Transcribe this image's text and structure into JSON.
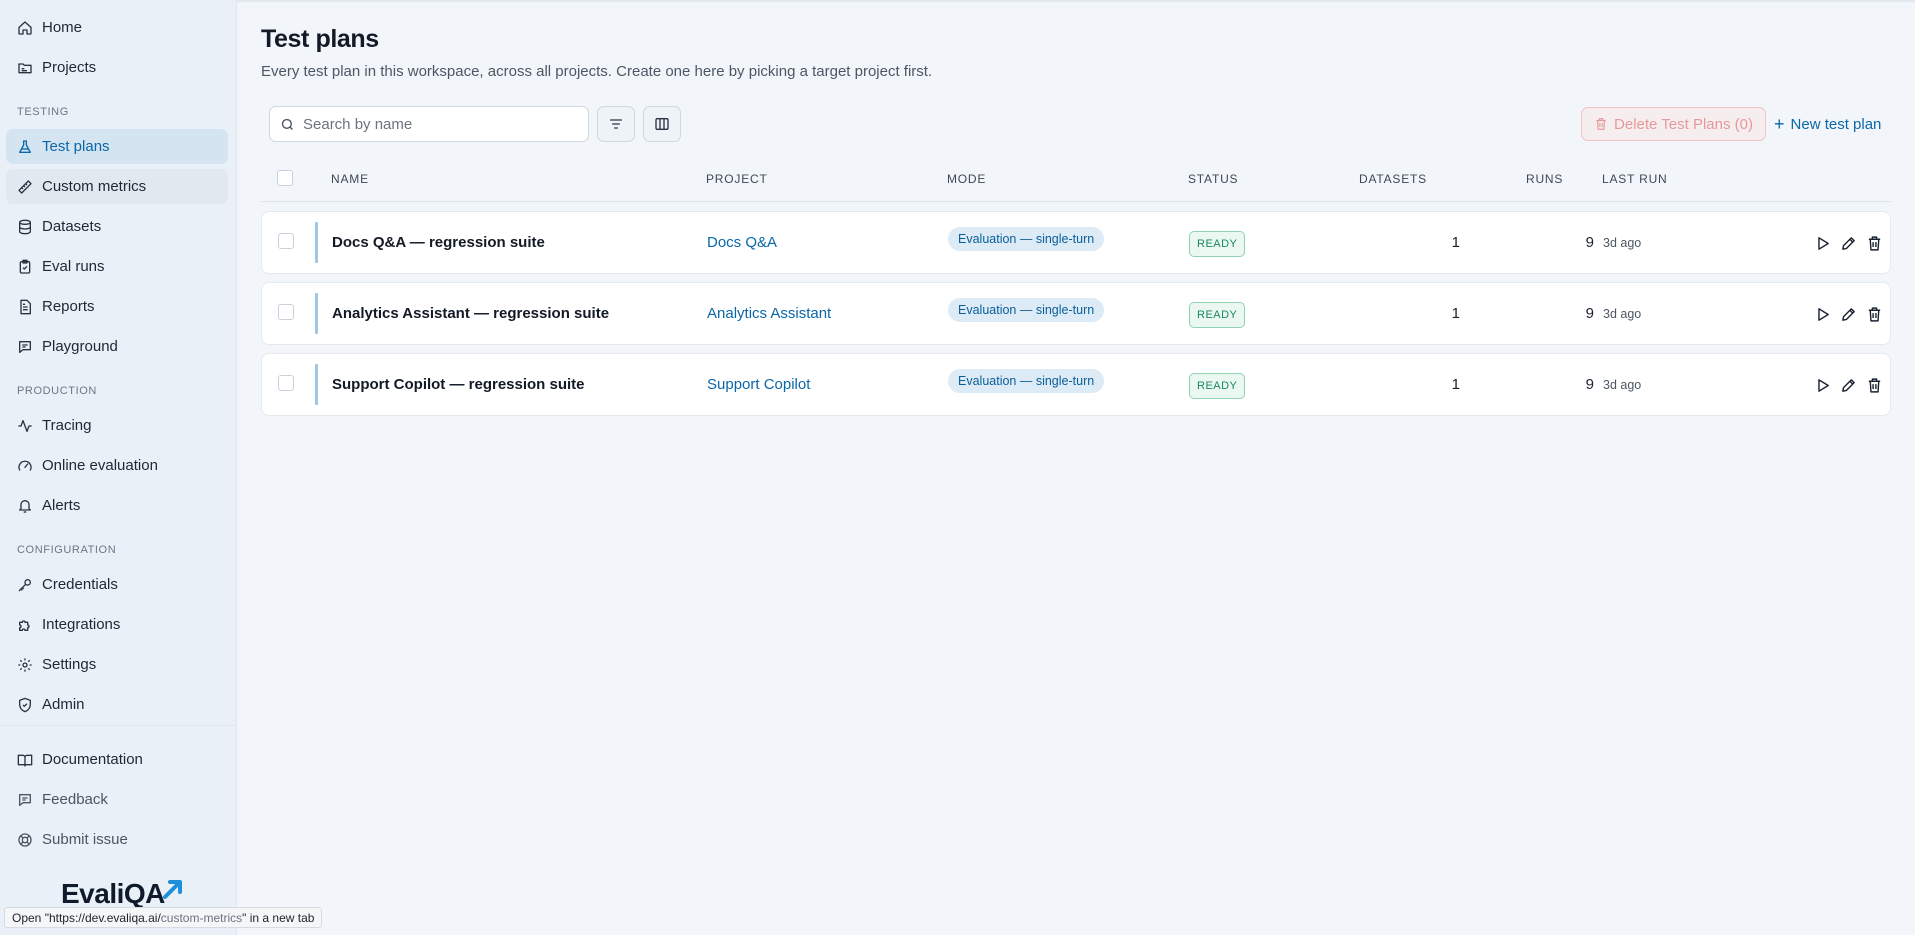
{
  "sidebar": {
    "items_top": [
      {
        "label": "Home",
        "icon": "home-icon"
      },
      {
        "label": "Projects",
        "icon": "folder-icon"
      }
    ],
    "section_testing": "TESTING",
    "items_testing": [
      {
        "label": "Test plans",
        "icon": "flask-icon"
      },
      {
        "label": "Custom metrics",
        "icon": "ruler-icon"
      },
      {
        "label": "Datasets",
        "icon": "database-icon"
      },
      {
        "label": "Eval runs",
        "icon": "clipboard-check-icon"
      },
      {
        "label": "Reports",
        "icon": "file-text-icon"
      },
      {
        "label": "Playground",
        "icon": "chat-icon"
      }
    ],
    "section_production": "PRODUCTION",
    "items_production": [
      {
        "label": "Tracing",
        "icon": "activity-icon"
      },
      {
        "label": "Online evaluation",
        "icon": "gauge-icon"
      },
      {
        "label": "Alerts",
        "icon": "bell-icon"
      }
    ],
    "section_configuration": "CONFIGURATION",
    "items_configuration": [
      {
        "label": "Credentials",
        "icon": "key-icon"
      },
      {
        "label": "Integrations",
        "icon": "puzzle-icon"
      },
      {
        "label": "Settings",
        "icon": "gear-icon"
      },
      {
        "label": "Admin",
        "icon": "shield-icon"
      }
    ],
    "items_bottom": [
      {
        "label": "Documentation",
        "icon": "book-icon"
      },
      {
        "label": "Feedback",
        "icon": "message-icon"
      },
      {
        "label": "Submit issue",
        "icon": "lifebuoy-icon"
      }
    ],
    "logo_text": "EvaliQA"
  },
  "statusbar": {
    "prefix": "Open \"",
    "url_main": "https://dev.evaliqa.ai/",
    "url_path": "custom-metrics",
    "suffix": "\" in a new tab"
  },
  "page": {
    "title": "Test plans",
    "subtitle": "Every test plan in this workspace, across all projects. Create one here by picking a target project first."
  },
  "toolbar": {
    "search_placeholder": "Search by name",
    "delete_label": "Delete Test Plans (0)",
    "new_label": "New test plan"
  },
  "table": {
    "headers": {
      "name": "NAME",
      "project": "PROJECT",
      "mode": "MODE",
      "status": "STATUS",
      "datasets": "DATASETS",
      "runs": "RUNS",
      "last_run": "LAST RUN"
    },
    "rows": [
      {
        "name": "Docs Q&A — regression suite",
        "project": "Docs Q&A",
        "mode": "Evaluation — single-turn",
        "status": "READY",
        "datasets": "1",
        "runs": "9",
        "last_run": "3d ago"
      },
      {
        "name": "Analytics Assistant — regression suite",
        "project": "Analytics Assistant",
        "mode": "Evaluation — single-turn",
        "status": "READY",
        "datasets": "1",
        "runs": "9",
        "last_run": "3d ago"
      },
      {
        "name": "Support Copilot — regression suite",
        "project": "Support Copilot",
        "mode": "Evaluation — single-turn",
        "status": "READY",
        "datasets": "1",
        "runs": "9",
        "last_run": "3d ago"
      }
    ]
  }
}
